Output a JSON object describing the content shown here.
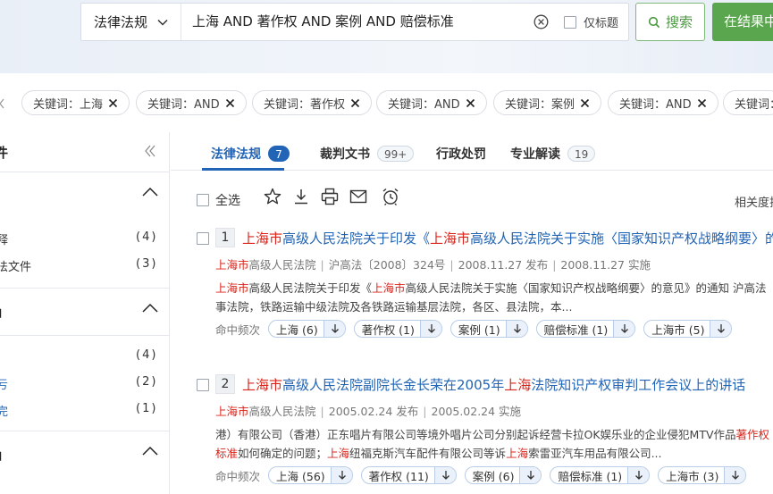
{
  "search": {
    "scope_label": "法律法规",
    "query": "上海 AND 著作权 AND 案例 AND 赔偿标准",
    "title_only_label": "仅标题",
    "search_button": "搜索",
    "in_results_button": "在结果中"
  },
  "chips": [
    {
      "label": "关键词：上海"
    },
    {
      "label": "关键词：AND"
    },
    {
      "label": "关键词：著作权"
    },
    {
      "label": "关键词：AND"
    },
    {
      "label": "关键词：案例"
    },
    {
      "label": "关键词：AND"
    },
    {
      "label": "关键词："
    }
  ],
  "sidebar": {
    "title": "件",
    "sections": [
      {
        "title": "J",
        "items": [
          {
            "label": "释",
            "count": "(4)"
          },
          {
            "label": "法文件",
            "count": "(3)"
          }
        ]
      },
      {
        "title": "」",
        "items": [
          {
            "label": "",
            "count": "(4)"
          },
          {
            "label": "亏",
            "count": "(2)"
          },
          {
            "label": "完",
            "count": "(1)"
          }
        ]
      },
      {
        "title": "」",
        "items": []
      }
    ]
  },
  "tabs": [
    {
      "label": "法律法规",
      "badge": "7",
      "active": true
    },
    {
      "label": "裁判文书",
      "badge": "99+",
      "active": false
    },
    {
      "label": "行政处罚",
      "badge": "",
      "active": false
    },
    {
      "label": "专业解读",
      "badge": "19",
      "active": false
    }
  ],
  "toolbar": {
    "select_all": "全选",
    "sort_label": "相关度排"
  },
  "results": [
    {
      "num": "1",
      "title_parts": [
        {
          "text": "上海市",
          "hl": true
        },
        {
          "text": "高级人民法院关于印发《",
          "hl": false
        },
        {
          "text": "上海市",
          "hl": true
        },
        {
          "text": "高级人民法院关于实施〈国家知识产权战略纲要〉的意见",
          "hl": false
        }
      ],
      "meta_org_hl": "上海市",
      "meta_org_rest": "高级人民法院",
      "meta_doc": "沪高法〔2008〕324号",
      "meta_publish": "2008.11.27 发布",
      "meta_effective": "2008.11.27 实施",
      "snippet_line1": [
        {
          "text": "上海市",
          "hl": true
        },
        {
          "text": "高级人民法院关于印发《",
          "hl": false
        },
        {
          "text": "上海市",
          "hl": true
        },
        {
          "text": "高级人民法院关于实施〈国家知识产权战略纲要〉的意见》的通知 沪高法〔",
          "hl": false
        }
      ],
      "snippet_line2": [
        {
          "text": "事法院，铁路运输中级法院及各铁路运输基层法院，各区、县法院，本...",
          "hl": false
        }
      ],
      "hits_label": "命中频次",
      "hits": [
        {
          "label": "上海 (6)"
        },
        {
          "label": "著作权 (1)"
        },
        {
          "label": "案例 (1)"
        },
        {
          "label": "赔偿标准 (1)"
        },
        {
          "label": "上海市 (5)"
        }
      ]
    },
    {
      "num": "2",
      "title_parts": [
        {
          "text": "上海市",
          "hl": true
        },
        {
          "text": "高级人民法院副院长金长荣在2005年",
          "hl": false
        },
        {
          "text": "上海",
          "hl": true
        },
        {
          "text": "法院知识产权审判工作会议上的讲话",
          "hl": false
        }
      ],
      "meta_org_hl": "上海市",
      "meta_org_rest": "高级人民法院",
      "meta_doc": "",
      "meta_publish": "2005.02.24 发布",
      "meta_effective": "2005.02.24 实施",
      "snippet_line1": [
        {
          "text": "港）有限公司（香港）正东唱片有限公司等境外唱片公司分别起诉经营卡拉OK娱乐业的企业侵犯MTV作品",
          "hl": false
        },
        {
          "text": "著作权",
          "hl": true
        }
      ],
      "snippet_line2": [
        {
          "text": "标准",
          "hl": true
        },
        {
          "text": "如何确定的问题；",
          "hl": false
        },
        {
          "text": "上海",
          "hl": true
        },
        {
          "text": "纽福克斯汽车配件有限公司等诉",
          "hl": false
        },
        {
          "text": "上海",
          "hl": true
        },
        {
          "text": "索雷亚汽车用品有限公司...",
          "hl": false
        }
      ],
      "hits_label": "命中频次",
      "hits": [
        {
          "label": "上海 (56)"
        },
        {
          "label": "著作权 (11)"
        },
        {
          "label": "案例 (6)"
        },
        {
          "label": "赔偿标准 (1)"
        },
        {
          "label": "上海市 (3)"
        }
      ]
    }
  ]
}
